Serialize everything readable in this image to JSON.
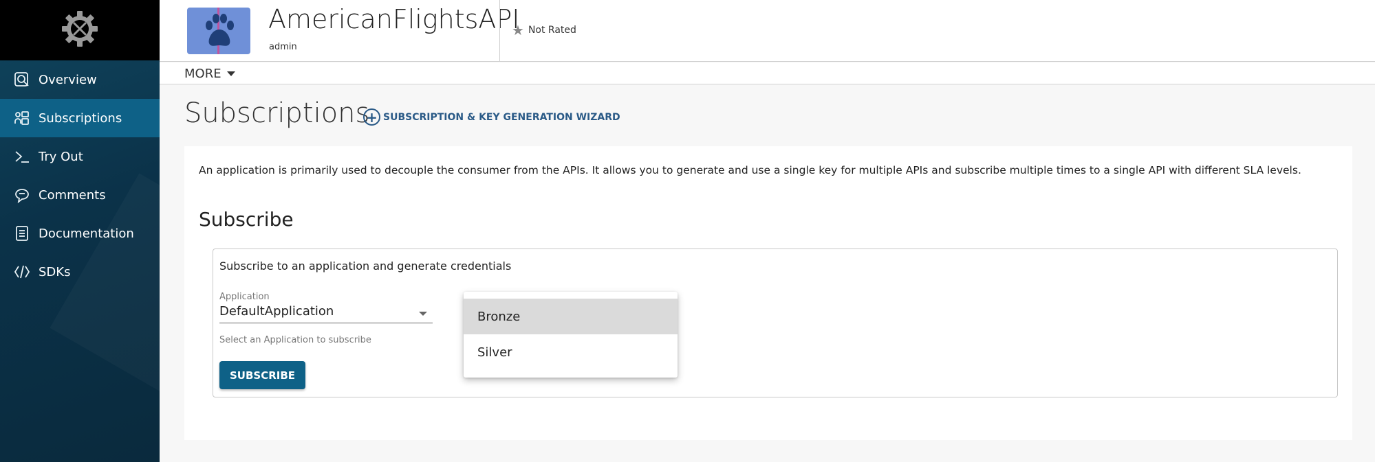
{
  "sidebar": {
    "logo_icon": "gear-tools-icon",
    "items": [
      {
        "label": "Overview",
        "icon": "search-doc-icon"
      },
      {
        "label": "Subscriptions",
        "icon": "subscriptions-icon",
        "active": true
      },
      {
        "label": "Try Out",
        "icon": "terminal-icon"
      },
      {
        "label": "Comments",
        "icon": "comment-icon"
      },
      {
        "label": "Documentation",
        "icon": "document-icon"
      },
      {
        "label": "SDKs",
        "icon": "code-icon"
      }
    ]
  },
  "header": {
    "api_name": "AmericanFlightsAPI",
    "owner": "admin",
    "rating_text": "Not Rated",
    "thumbnail_icon": "paw-icon"
  },
  "more_menu": {
    "label": "MORE"
  },
  "page": {
    "title": "Subscriptions",
    "wizard_label": "SUBSCRIPTION & KEY GENERATION WIZARD",
    "description": "An application is primarily used to decouple the consumer from the APIs. It allows you to generate and use a single key for multiple APIs and subscribe multiple times to a single API with different SLA levels.",
    "subscribe_heading": "Subscribe"
  },
  "subscribe_form": {
    "box_title": "Subscribe to an application and generate credentials",
    "application_label": "Application",
    "application_value": "DefaultApplication",
    "application_help": "Select an Application to subscribe",
    "subscribe_button": "SUBSCRIBE"
  },
  "tier_dropdown": {
    "options": [
      "Bronze",
      "Silver"
    ],
    "highlighted": "Bronze"
  },
  "colors": {
    "sidebar_active": "#0e6187",
    "accent_link": "#2a5a87",
    "button": "#0e6187"
  }
}
